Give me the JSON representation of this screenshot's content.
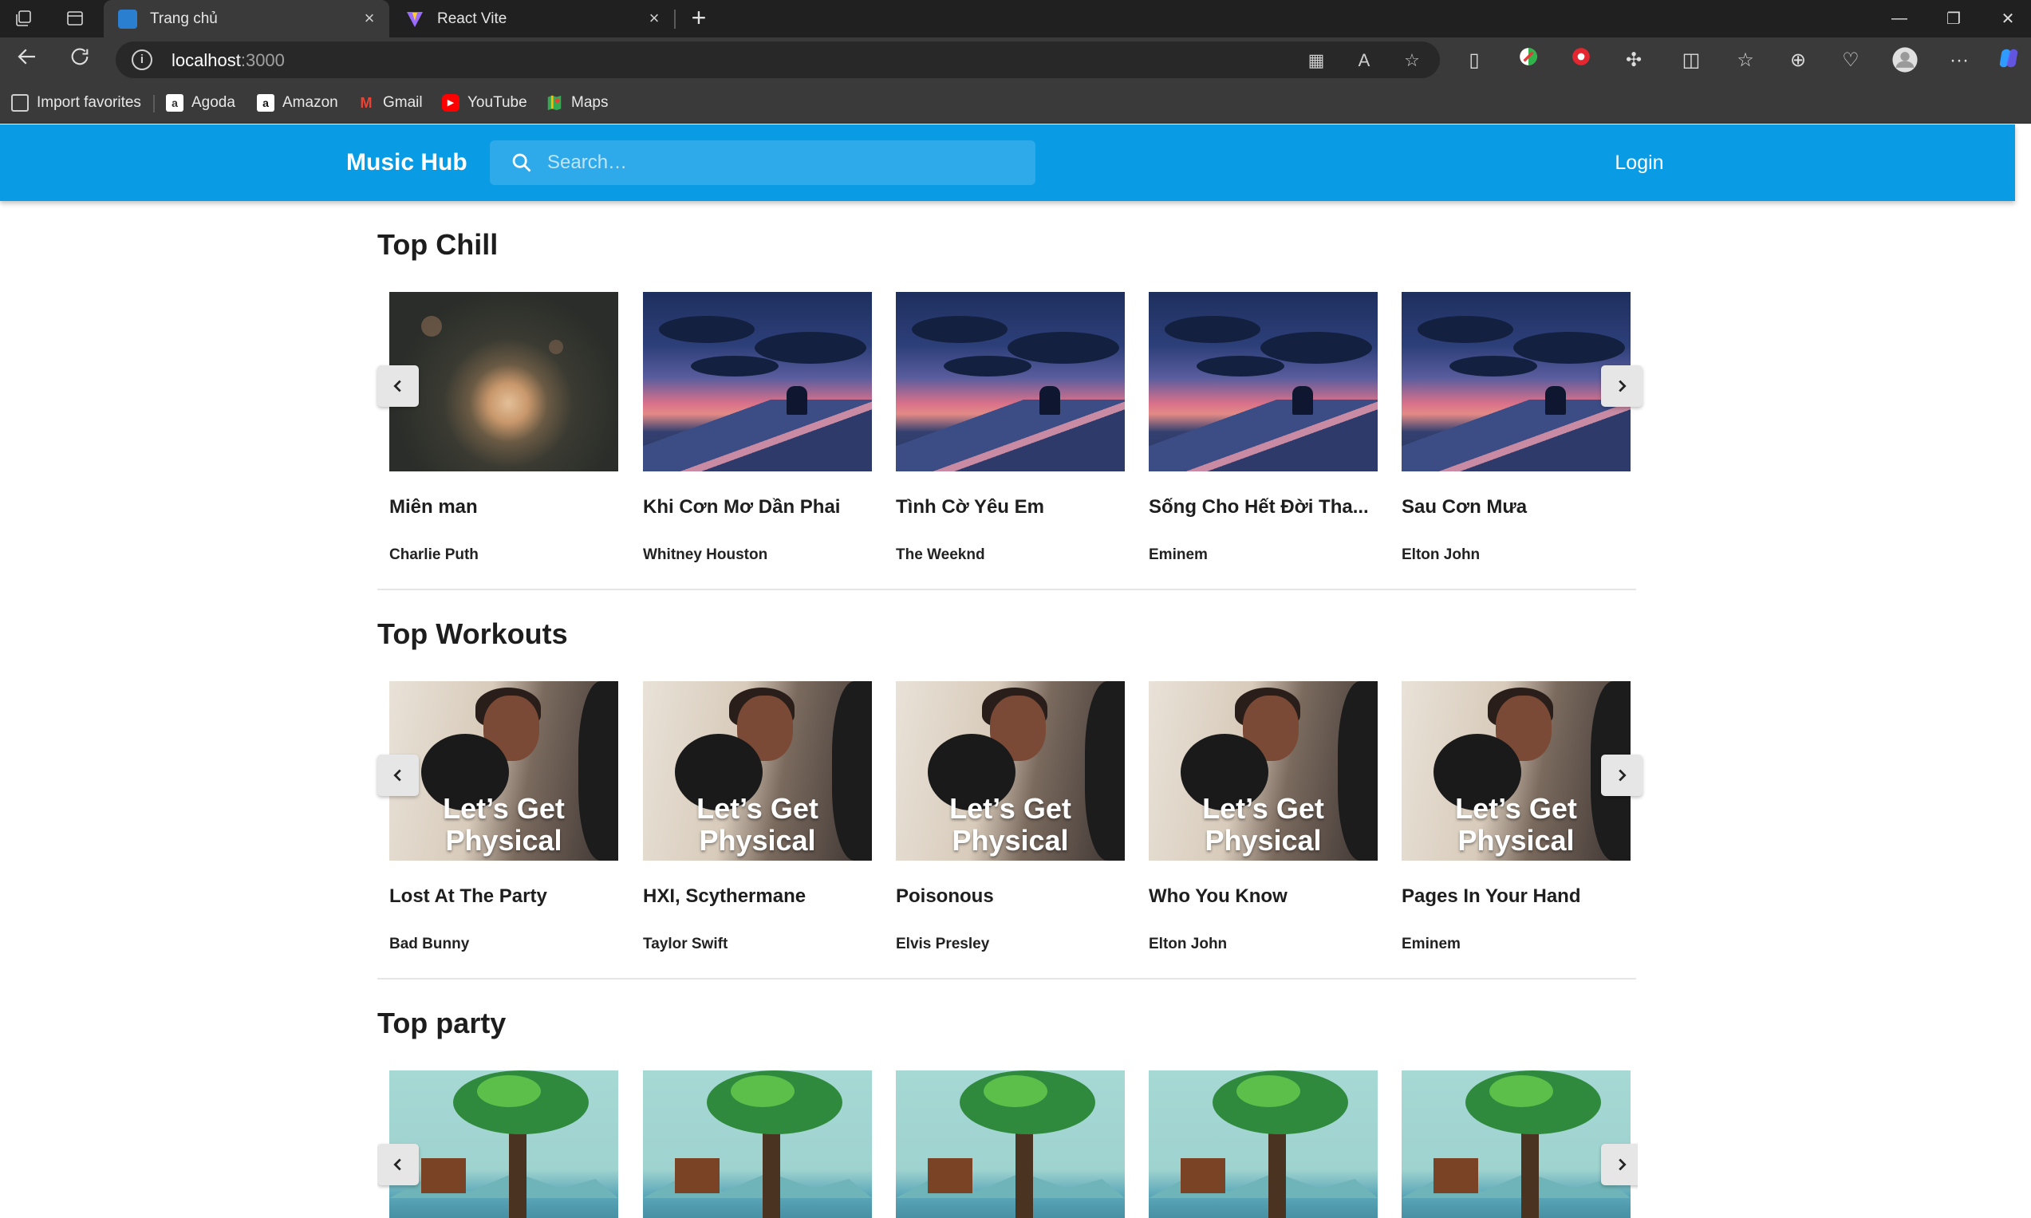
{
  "browser": {
    "tabs": [
      {
        "label": "Trang chủ",
        "active": true
      },
      {
        "label": "React Vite",
        "active": false
      }
    ],
    "address": {
      "host": "localhost",
      "port": ":3000"
    },
    "bookmarks": [
      {
        "label": "Import favorites",
        "icon": "import-icon"
      },
      {
        "label": "Agoda",
        "icon": "agoda-icon"
      },
      {
        "label": "Amazon",
        "icon": "amazon-icon"
      },
      {
        "label": "Gmail",
        "icon": "gmail-icon"
      },
      {
        "label": "YouTube",
        "icon": "youtube-icon"
      },
      {
        "label": "Maps",
        "icon": "maps-icon"
      }
    ]
  },
  "header": {
    "brand": "Music Hub",
    "search_placeholder": "Search…",
    "login_label": "Login",
    "accent_color": "#0a9be5"
  },
  "sections": [
    {
      "title": "Top Chill",
      "items": [
        {
          "title": "Miên man",
          "artist": "Charlie Puth",
          "art": "flower"
        },
        {
          "title": "Khi Cơn Mơ Dần Phai",
          "artist": "Whitney Houston",
          "art": "sunset"
        },
        {
          "title": "Tình Cờ Yêu Em",
          "artist": "The Weeknd",
          "art": "sunset"
        },
        {
          "title": "Sống Cho Hết Đời Tha...",
          "artist": "Eminem",
          "art": "sunset"
        },
        {
          "title": "Sau Cơn Mưa",
          "artist": "Elton John",
          "art": "sunset"
        }
      ]
    },
    {
      "title": "Top Workouts",
      "items": [
        {
          "title": "Lost At The Party",
          "artist": "Bad Bunny",
          "art": "workout",
          "art_caption": "Let’s Get Physical"
        },
        {
          "title": "HXI, Scythermane",
          "artist": "Taylor Swift",
          "art": "workout",
          "art_caption": "Let’s Get Physical"
        },
        {
          "title": "Poisonous",
          "artist": "Elvis Presley",
          "art": "workout",
          "art_caption": "Let’s Get Physical"
        },
        {
          "title": "Who You Know",
          "artist": "Elton John",
          "art": "workout",
          "art_caption": "Let’s Get Physical"
        },
        {
          "title": "Pages In Your Hand",
          "artist": "Eminem",
          "art": "workout",
          "art_caption": "Let’s Get Physical"
        }
      ]
    },
    {
      "title": "Top party",
      "items": [
        {
          "title": "",
          "artist": "",
          "art": "lake"
        },
        {
          "title": "",
          "artist": "",
          "art": "lake"
        },
        {
          "title": "",
          "artist": "",
          "art": "lake"
        },
        {
          "title": "",
          "artist": "",
          "art": "lake"
        },
        {
          "title": "",
          "artist": "",
          "art": "lake"
        }
      ]
    }
  ]
}
